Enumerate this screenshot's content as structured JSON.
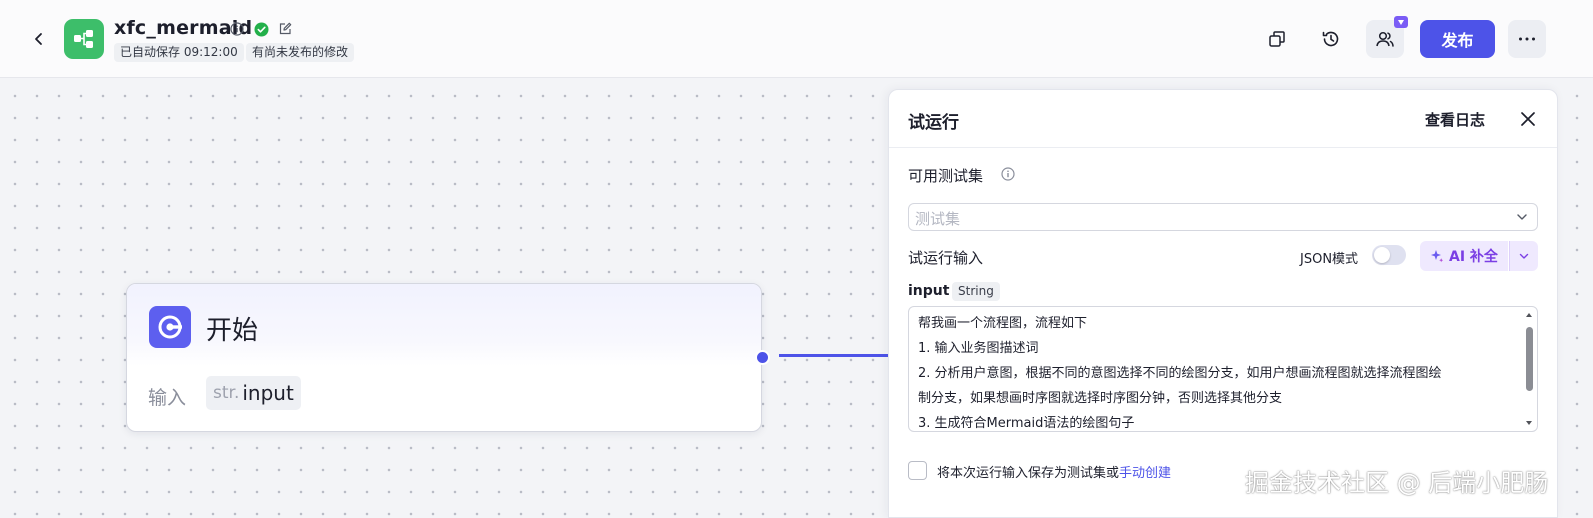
{
  "topbar": {
    "app_name": "xfc_mermaid",
    "autosave_tag": "已自动保存 09:12:00",
    "unpublished_tag": "有尚未发布的修改",
    "publish_label": "发布",
    "logo_color": "#3dbe6a",
    "accent_color": "#4d53e8"
  },
  "start_node": {
    "title": "开始",
    "input_label": "输入",
    "input_type": "str.",
    "input_name": "input"
  },
  "panel": {
    "title": "试运行",
    "view_log": "查看日志",
    "testset_label": "可用测试集",
    "testset_placeholder": "测试集",
    "run_input_label": "试运行输入",
    "json_mode_label": "JSON模式",
    "ai_button_label": "AI 补全",
    "variable_name": "input",
    "variable_type": "String",
    "input_lines": [
      "帮我画一个流程图，流程如下",
      "1. 输入业务图描述词",
      "2. 分析用户意图，根据不同的意图选择不同的绘图分支，如用户想画流程图就选择流程图绘",
      "制分支，如果想画时序图就选择时序图分钟，否则选择其他分支",
      "3. 生成符合Mermaid语法的绘图句子"
    ],
    "save_text": "将本次运行输入保存为测试集或",
    "manual_create_link": "手动创建"
  },
  "watermark": "掘金技术社区 @ 后端小肥肠"
}
